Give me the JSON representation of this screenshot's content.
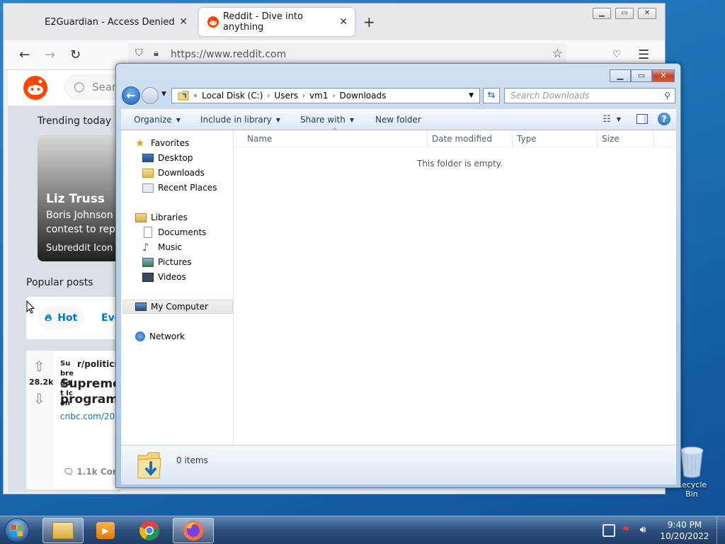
{
  "firefox": {
    "tabs": [
      {
        "label": "E2Guardian - Access Denied"
      },
      {
        "label": "Reddit - Dive into anything"
      }
    ],
    "url": "https://www.reddit.com"
  },
  "reddit": {
    "search_placeholder": "Sear",
    "trending_title": "Trending today",
    "trend_headline": "Liz Truss",
    "trend_sub": "Boris Johnson e contest to repla",
    "trend_source": "Subreddit Icon",
    "popular_title": "Popular posts",
    "sort_hot": "Hot",
    "sort_every": "Eve",
    "vote_count": "28.2k",
    "subreddit": "r/politics",
    "subreddit_icon_alt": "Subreddit Icon",
    "post_title": "Supreme program",
    "post_link": "cnbc.com/202",
    "comments": "1.1k Com"
  },
  "explorer": {
    "breadcrumb": [
      "Local Disk (C:)",
      "Users",
      "vm1",
      "Downloads"
    ],
    "search_placeholder": "Search Downloads",
    "commands": [
      "Organize",
      "Include in library",
      "Share with",
      "New folder"
    ],
    "nav": {
      "favorites": "Favorites",
      "desktop": "Desktop",
      "downloads": "Downloads",
      "recent": "Recent Places",
      "libraries": "Libraries",
      "documents": "Documents",
      "music": "Music",
      "pictures": "Pictures",
      "videos": "Videos",
      "computer": "My Computer",
      "network": "Network"
    },
    "columns": [
      "Name",
      "Date modified",
      "Type",
      "Size"
    ],
    "empty_message": "This folder is empty.",
    "items_count": "0 items"
  },
  "desktop": {
    "recycle_bin": "Recycle Bin"
  },
  "taskbar": {
    "time": "9:40 PM",
    "date": "10/20/2022"
  },
  "colors": {
    "reddit_orange": "#ff4500",
    "win_blue": "#1e62b4"
  }
}
